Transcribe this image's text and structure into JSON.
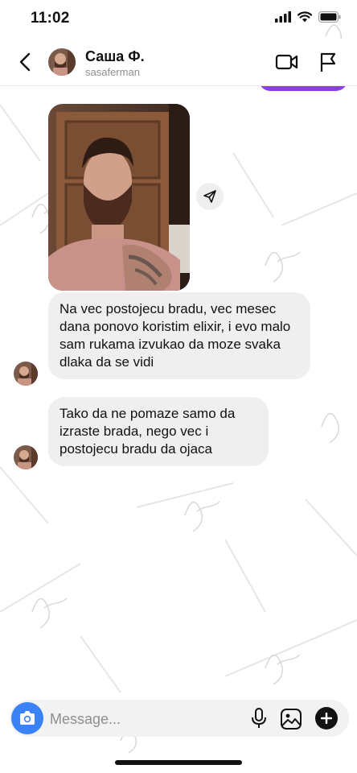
{
  "status_bar": {
    "time": "11:02"
  },
  "header": {
    "name": "Саша Ф.",
    "username": "sasaferman",
    "icons": {
      "back": "chevron-left-icon",
      "video": "video-camera-icon",
      "flag": "flag-icon"
    }
  },
  "thread": {
    "photo": {
      "icon": "share-send-icon"
    },
    "messages": [
      {
        "text": "Na vec postojecu bradu, vec mesec dana ponovo koristim elixir, i evo malo sam rukama izvukao da moze svaka dlaka da se vidi"
      },
      {
        "text": "Tako da ne pomaze samo da izraste brada, nego vec i postojecu bradu da ojaca"
      }
    ]
  },
  "composer": {
    "placeholder": "Message...",
    "icons": {
      "camera": "camera-icon",
      "mic": "microphone-icon",
      "gallery": "image-icon",
      "add": "plus-icon"
    }
  },
  "colors": {
    "accent": "#3b82f6",
    "sent_bubble": "#8a3cf0",
    "received_bubble": "#efefef"
  }
}
